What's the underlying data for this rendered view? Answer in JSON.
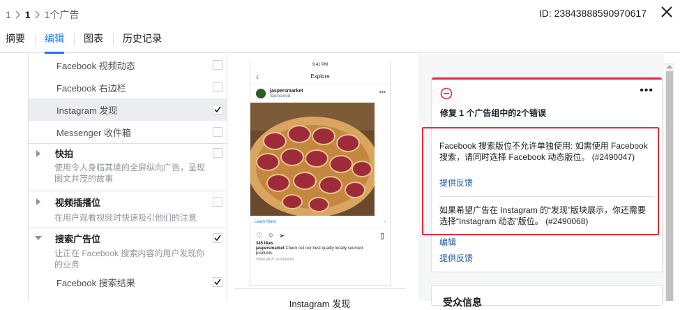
{
  "breadcrumb": {
    "level1": "1",
    "level2": "1",
    "level3": "1个广告"
  },
  "ad_id": "ID: 23843888590970617",
  "tabs": [
    {
      "label": "摘要"
    },
    {
      "label": "编辑"
    },
    {
      "label": "图表"
    },
    {
      "label": "历史记录"
    }
  ],
  "placements": {
    "items": [
      {
        "label": "Facebook 视频动态",
        "checked": false
      },
      {
        "label": "Facebook 右边栏",
        "checked": false
      },
      {
        "label": "Instagram 发现",
        "checked": true
      },
      {
        "label": "Messenger 收件箱",
        "checked": false
      }
    ],
    "sections": [
      {
        "title": "快拍",
        "desc": "使用令人身临其境的全屏纵向广告，呈现图文并茂的故事",
        "checked": false
      },
      {
        "title": "视频插播位",
        "desc": "在用户观看视频时快速吸引他们的注意",
        "checked": false
      },
      {
        "title": "搜索广告位",
        "desc": "让正在 Facebook 搜索内容的用户发现你的业务",
        "checked": true,
        "subitem": "Facebook 搜索结果",
        "subitem_checked": true
      }
    ]
  },
  "preview": {
    "status_time": "9:41 PM",
    "nav_title": "Explore",
    "username": "jaspersmarket",
    "sponsored": "Sponsored",
    "learn_more": "Learn More",
    "likes": "345 likes",
    "caption_user": "jaspersmarket",
    "caption_text": "Check out our best quality locally sourced products.",
    "view_comments": "View all 8 comments",
    "title": "Instagram 发现"
  },
  "errors": {
    "title": "修复 1 个广告组中的2个错误",
    "items": [
      {
        "text": "Facebook 搜索版位不允许单独使用: 如需使用 Facebook 搜索，请同时选择 Facebook 动态版位。 (#2490047)",
        "feedback": "提供反馈"
      },
      {
        "text": "如果希望广告在 Instagram 的“发现”版块展示，你还需要选择“Instagram 动态”版位。 (#2490068)",
        "edit": "编辑",
        "feedback": "提供反馈"
      }
    ]
  },
  "next_card_title": "受众信息",
  "colors": {
    "accent": "#1877f2",
    "error": "#e02f3e",
    "link": "#1c5aa8"
  }
}
